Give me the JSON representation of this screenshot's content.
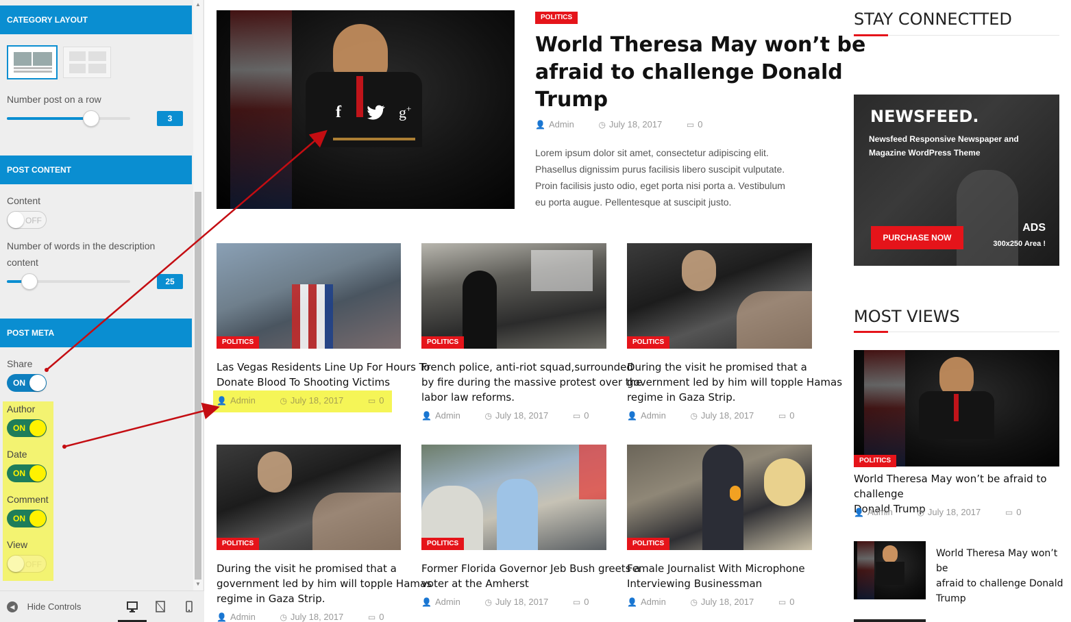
{
  "sidebar": {
    "category_layout": {
      "title": "CATEGORY LAYOUT"
    },
    "number_post_row": {
      "label": "Number post on a row",
      "value": "3",
      "level": 0.68
    },
    "post_content": {
      "title": "POST CONTENT"
    },
    "content": {
      "label": "Content",
      "state": "OFF"
    },
    "words": {
      "label_line1": "Number of words in the description",
      "label_line2": "content",
      "value": "25",
      "level": 0.18
    },
    "post_meta": {
      "title": "POST META"
    },
    "share": {
      "label": "Share",
      "state": "ON"
    },
    "author": {
      "label": "Author",
      "state": "ON"
    },
    "date": {
      "label": "Date",
      "state": "ON"
    },
    "comment": {
      "label": "Comment",
      "state": "ON"
    },
    "view": {
      "label": "View",
      "state": "OFF"
    },
    "footer": {
      "hide_controls": "Hide Controls"
    }
  },
  "featured": {
    "badge": "POLITICS",
    "title_line1": "World Theresa May won’t be",
    "title_line2": "afraid to challenge Donald",
    "title_line3": "Trump",
    "author": "Admin",
    "date": "July 18, 2017",
    "comments": "0",
    "excerpt_line1": "Lorem ipsum dolor sit amet, consectetur adipiscing elit.",
    "excerpt_line2": "Phasellus dignissim purus facilisis libero suscipit vulputate.",
    "excerpt_line3": "Proin facilisis justo odio, eget porta nisi porta a. Vestibulum",
    "excerpt_line4": "eu porta augue. Pellentesque at suscipit justo."
  },
  "grid": [
    {
      "badge": "POLITICS",
      "title_line1": "Las Vegas Residents Line Up For Hours To",
      "title_line2": "Donate Blood To Shooting Victims",
      "title_line3": "",
      "author": "Admin",
      "date": "July 18, 2017",
      "comments": "0"
    },
    {
      "badge": "POLITICS",
      "title_line1": "French police, anti-riot squad,surrounded",
      "title_line2": "by fire during the massive protest over the",
      "title_line3": "labor law reforms.",
      "author": "Admin",
      "date": "July 18, 2017",
      "comments": "0"
    },
    {
      "badge": "POLITICS",
      "title_line1": "During the visit he promised that a",
      "title_line2": "government led by him will topple Hamas",
      "title_line3": "regime in Gaza Strip.",
      "author": "Admin",
      "date": "July 18, 2017",
      "comments": "0"
    },
    {
      "badge": "POLITICS",
      "title_line1": "During the visit he promised that a",
      "title_line2": "government led by him will topple Hamas",
      "title_line3": "regime in Gaza Strip.",
      "author": "Admin",
      "date": "July 18, 2017",
      "comments": "0"
    },
    {
      "badge": "POLITICS",
      "title_line1": "Former Florida Governor Jeb Bush greets a",
      "title_line2": "voter at the Amherst",
      "title_line3": "",
      "author": "Admin",
      "date": "July 18, 2017",
      "comments": "0"
    },
    {
      "badge": "POLITICS",
      "title_line1": "Female Journalist With Microphone",
      "title_line2": "Interviewing Businessman",
      "title_line3": "",
      "author": "Admin",
      "date": "July 18, 2017",
      "comments": "0"
    }
  ],
  "right": {
    "stay_connected": "STAY CONNECTTED",
    "ad": {
      "brand": "NEWSFEED.",
      "tag_line1": "Newsfeed Responsive Newspaper and",
      "tag_line2": "Magazine WordPress Theme",
      "cta": "PURCHASE NOW",
      "ads": "ADS",
      "size": "300x250 Area !"
    },
    "most_views": "MOST VIEWS",
    "top_story": {
      "badge": "POLITICS",
      "title_line1": "World Theresa May won’t be afraid to challenge",
      "title_line2": "Donald Trump",
      "author": "Admin",
      "date": "July 18, 2017",
      "comments": "0"
    },
    "small_story": {
      "title_line1": "World Theresa May won’t be",
      "title_line2": "afraid to challenge Donald",
      "title_line3": "Trump"
    }
  },
  "colors": {
    "customizer_blue": "#0a8ed1",
    "accent_red": "#e5141a",
    "highlight_yellow": "#f3f371",
    "arrow_red": "#c40d12"
  }
}
